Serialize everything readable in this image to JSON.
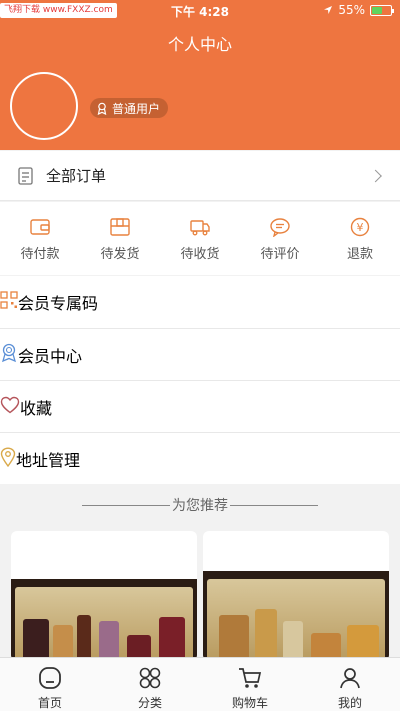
{
  "status_bar": {
    "carrier": "飞翔下载 www.FXXZ.com",
    "time": "下午 4:28",
    "battery": "55%",
    "battery_level": 0.55
  },
  "header": {
    "title": "个人中心",
    "user_level": "普通用户"
  },
  "orders": {
    "label": "全部订单"
  },
  "order_status": [
    {
      "label": "待付款",
      "icon": "wallet-icon"
    },
    {
      "label": "待发货",
      "icon": "package-icon"
    },
    {
      "label": "待收货",
      "icon": "truck-icon"
    },
    {
      "label": "待评价",
      "icon": "chat-bubble-icon"
    },
    {
      "label": "退款",
      "icon": "refund-icon"
    }
  ],
  "menu": [
    {
      "label": "会员专属码",
      "icon": "qr-code-icon"
    },
    {
      "label": "会员中心",
      "icon": "member-badge-icon"
    },
    {
      "label": "收藏",
      "icon": "heart-icon"
    },
    {
      "label": "地址管理",
      "icon": "location-pin-icon"
    }
  ],
  "recommend_title": "为您推荐",
  "tabbar": [
    {
      "label": "首页",
      "icon": "home-icon"
    },
    {
      "label": "分类",
      "icon": "category-icon"
    },
    {
      "label": "购物车",
      "icon": "cart-icon"
    },
    {
      "label": "我的",
      "icon": "profile-icon"
    }
  ],
  "colors": {
    "primary": "#ee7540",
    "accent_icon": "#e8823f",
    "text": "#222222"
  }
}
